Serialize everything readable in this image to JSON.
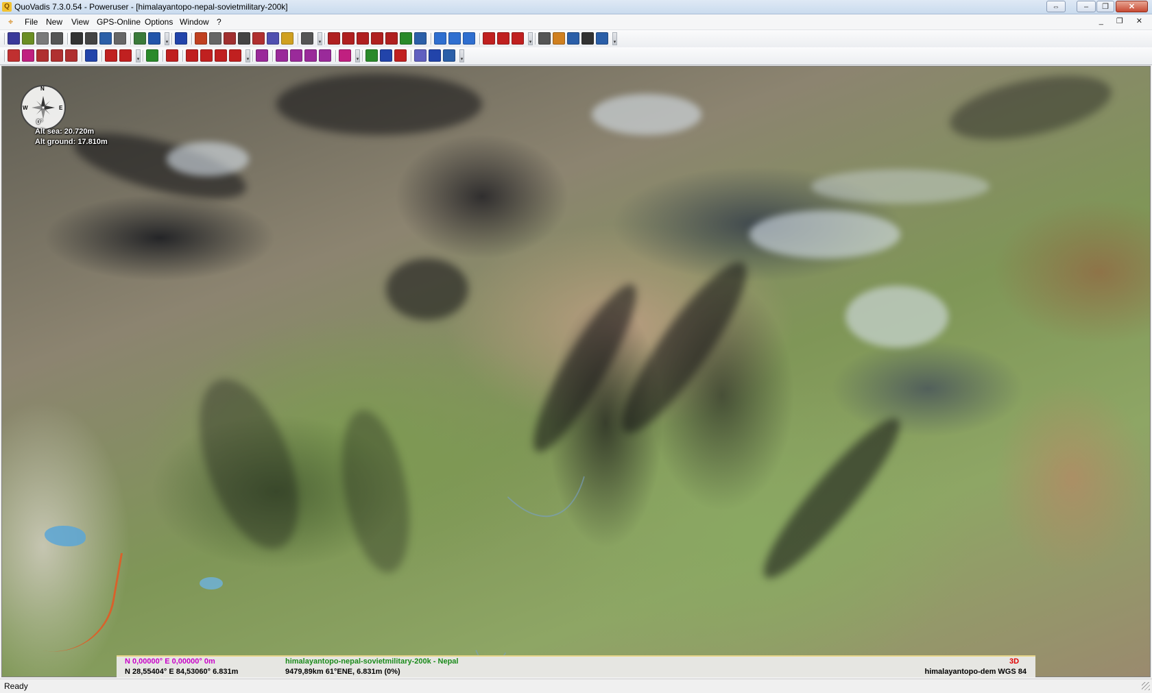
{
  "window": {
    "app_icon": "Q",
    "title": "QuoVadis 7.3.0.54 - Poweruser - [himalayantopo-nepal-sovietmilitary-200k]",
    "controls": {
      "restore_icon": "⇔",
      "minimize_icon": "–",
      "maximize_icon": "❐",
      "close_icon": "✕"
    }
  },
  "menubar": {
    "icon": "target-icon",
    "items": [
      "File",
      "New",
      "View",
      "GPS-Online",
      "Options",
      "Window",
      "?"
    ],
    "mdi_controls": "_ ❐ ✕"
  },
  "toolbar1": {
    "groups": [
      [
        {
          "icon": "cut-icon",
          "color": "#3a3a9a"
        },
        {
          "icon": "map-import-icon",
          "color": "#6b8e23"
        },
        {
          "icon": "save-icon",
          "color": "#7a7a7a"
        },
        {
          "icon": "print-icon",
          "color": "#555"
        }
      ],
      [
        {
          "icon": "binoculars-icon",
          "color": "#333"
        },
        {
          "icon": "binoculars-search-icon",
          "color": "#444"
        },
        {
          "icon": "grid-icon",
          "color": "#2b5fa8"
        },
        {
          "icon": "copy-icon",
          "color": "#666"
        }
      ],
      [
        {
          "icon": "mountain-icon",
          "color": "#3a7a3a"
        },
        {
          "icon": "region-icon",
          "color": "#2255aa"
        }
      ],
      [
        {
          "icon": "gps-icon",
          "color": "#2244aa"
        }
      ],
      [
        {
          "icon": "list-icon",
          "color": "#c04020"
        },
        {
          "icon": "layers-icon",
          "color": "#666"
        },
        {
          "icon": "route-icon",
          "color": "#a03030"
        },
        {
          "icon": "clock-icon",
          "color": "#444"
        },
        {
          "icon": "book-icon",
          "color": "#b03030"
        },
        {
          "icon": "network-icon",
          "color": "#5050b0"
        },
        {
          "icon": "ruler-icon",
          "color": "#d0a020"
        }
      ],
      [
        {
          "icon": "tools-icon",
          "color": "#555"
        }
      ],
      [
        {
          "icon": "zoom-in-icon",
          "color": "#b02020"
        },
        {
          "icon": "zoom-out-icon",
          "color": "#b02020"
        },
        {
          "icon": "zoom-fit-icon",
          "color": "#b02020"
        },
        {
          "icon": "zoom-area-icon",
          "color": "#b02020"
        },
        {
          "icon": "zoom-window-icon",
          "color": "#b02020"
        },
        {
          "icon": "3d-icon",
          "color": "#2a8a2a"
        },
        {
          "icon": "zoom-select-icon",
          "color": "#2b5fa8"
        }
      ],
      [
        {
          "icon": "back-icon",
          "color": "#2f6fd0"
        },
        {
          "icon": "forward-icon",
          "color": "#2f6fd0"
        },
        {
          "icon": "download-icon",
          "color": "#2f6fd0"
        }
      ],
      [
        {
          "icon": "waypoint-add-icon",
          "color": "#c02020"
        },
        {
          "icon": "waypoint-edit-icon",
          "color": "#c02020"
        },
        {
          "icon": "waypoint-delete-icon",
          "color": "#c02020"
        }
      ],
      [
        {
          "icon": "move-icon",
          "color": "#555"
        },
        {
          "icon": "pencil-icon",
          "color": "#d08020"
        },
        {
          "icon": "compass-icon",
          "color": "#2b5fa8"
        },
        {
          "icon": "grid-lines-icon",
          "color": "#333"
        },
        {
          "icon": "display-icon",
          "color": "#2b5fa8"
        }
      ]
    ]
  },
  "toolbar2": {
    "groups": [
      [
        {
          "icon": "doc-new-icon",
          "color": "#c03030"
        },
        {
          "icon": "doc-open-icon",
          "color": "#c02080"
        },
        {
          "icon": "doc-route-icon",
          "color": "#b03030"
        },
        {
          "icon": "doc-copy-icon",
          "color": "#b03030"
        },
        {
          "icon": "doc-track-icon",
          "color": "#b03030"
        }
      ],
      [
        {
          "icon": "edit-doc-icon",
          "color": "#2244aa"
        }
      ],
      [
        {
          "icon": "rewind-icon",
          "color": "#c02020"
        },
        {
          "icon": "record-back-icon",
          "color": "#c02020"
        }
      ],
      [
        {
          "icon": "map-color-icon",
          "color": "#2a8a2a"
        }
      ],
      [
        {
          "icon": "search-point-icon",
          "color": "#c02020"
        }
      ],
      [
        {
          "icon": "select-icon",
          "color": "#c02020"
        },
        {
          "icon": "select-2-icon",
          "color": "#c02020"
        },
        {
          "icon": "select-3-icon",
          "color": "#c02020"
        },
        {
          "icon": "select-all-icon",
          "color": "#c02020"
        }
      ],
      [
        {
          "icon": "track-split-icon",
          "color": "#9a2a9a"
        }
      ],
      [
        {
          "icon": "mark-1-icon",
          "color": "#9a2a9a"
        },
        {
          "icon": "mark-2-icon",
          "color": "#9a2a9a"
        },
        {
          "icon": "mark-3-icon",
          "color": "#9a2a9a"
        },
        {
          "icon": "mark-4-icon",
          "color": "#9a2a9a"
        }
      ],
      [
        {
          "icon": "poi-icon",
          "color": "#c02080"
        }
      ],
      [
        {
          "icon": "sync-icon",
          "color": "#2a8a2a"
        },
        {
          "icon": "transfer-icon",
          "color": "#2244aa"
        },
        {
          "icon": "export-icon",
          "color": "#c02020"
        }
      ],
      [
        {
          "icon": "db-icon",
          "color": "#6060c0"
        },
        {
          "icon": "db-search-icon",
          "color": "#2244aa"
        },
        {
          "icon": "db-export-icon",
          "color": "#2b5fa8"
        }
      ]
    ]
  },
  "map": {
    "compass": {
      "north": "N",
      "east": "E",
      "west": "W",
      "degree": "0°"
    },
    "alt_sea": "Alt sea: 20.720m",
    "alt_ground": "Alt ground: 17.810m"
  },
  "infobar": {
    "cursor_pos": "N 0,00000°  E 0,00000°  0m",
    "map_name": "himalayantopo-nepal-sovietmilitary-200k - Nepal",
    "mode": "3D",
    "position": "N 28,55404°  E 84,53060°  6.831m",
    "distance": "9479,89km 61°ENE,  6.831m (0%)",
    "dem": "himalayantopo-dem  WGS 84"
  },
  "status": {
    "text": "Ready"
  }
}
